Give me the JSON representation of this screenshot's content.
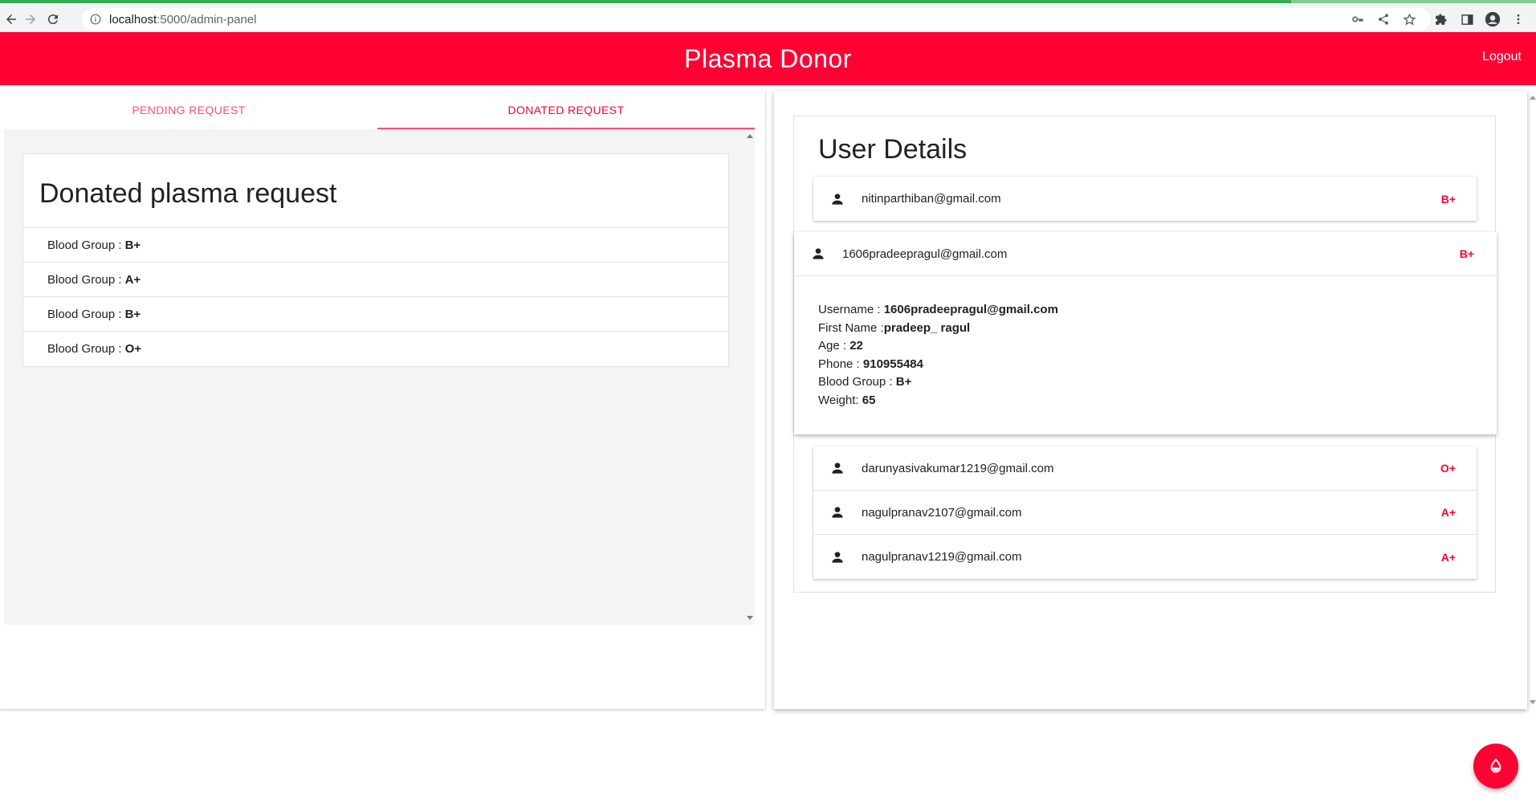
{
  "browser": {
    "url_host": "localhost",
    "url_rest": ":5000/admin-panel"
  },
  "appbar": {
    "title": "Plasma Donor",
    "logout_label": "Logout"
  },
  "tabs": [
    {
      "label": "PENDING REQUEST",
      "active": false
    },
    {
      "label": "DONATED REQUEST",
      "active": true
    }
  ],
  "donated": {
    "title": "Donated plasma request",
    "row_label": "Blood Group :",
    "rows": [
      "B+",
      "A+",
      "B+",
      "O+"
    ]
  },
  "user_details": {
    "title": "User Details",
    "users_top": [
      {
        "email": "nitinparthiban@gmail.com",
        "blood_group": "B+"
      }
    ],
    "expanded": {
      "email": "1606pradeepragul@gmail.com",
      "blood_group": "B+",
      "fields": [
        {
          "label": "Username : ",
          "value": "1606pradeepragul@gmail.com"
        },
        {
          "label": "First Name :",
          "value": "pradeep_ ragul"
        },
        {
          "label": "Age : ",
          "value": "22"
        },
        {
          "label": "Phone : ",
          "value": "910955484"
        },
        {
          "label": "Blood Group : ",
          "value": "B+"
        },
        {
          "label": "Weight: ",
          "value": "65"
        }
      ]
    },
    "users_bottom": [
      {
        "email": "darunyasivakumar1219@gmail.com",
        "blood_group": "O+"
      },
      {
        "email": "nagulpranav2107@gmail.com",
        "blood_group": "A+"
      },
      {
        "email": "nagulpranav1219@gmail.com",
        "blood_group": "A+"
      }
    ]
  },
  "colors": {
    "primary": "#ff0033",
    "tab_inactive": "#ff4d73",
    "panel_bg": "#f4f4f4"
  },
  "icons": {
    "fab": "blood-drop-icon",
    "list_item": "person-icon"
  }
}
